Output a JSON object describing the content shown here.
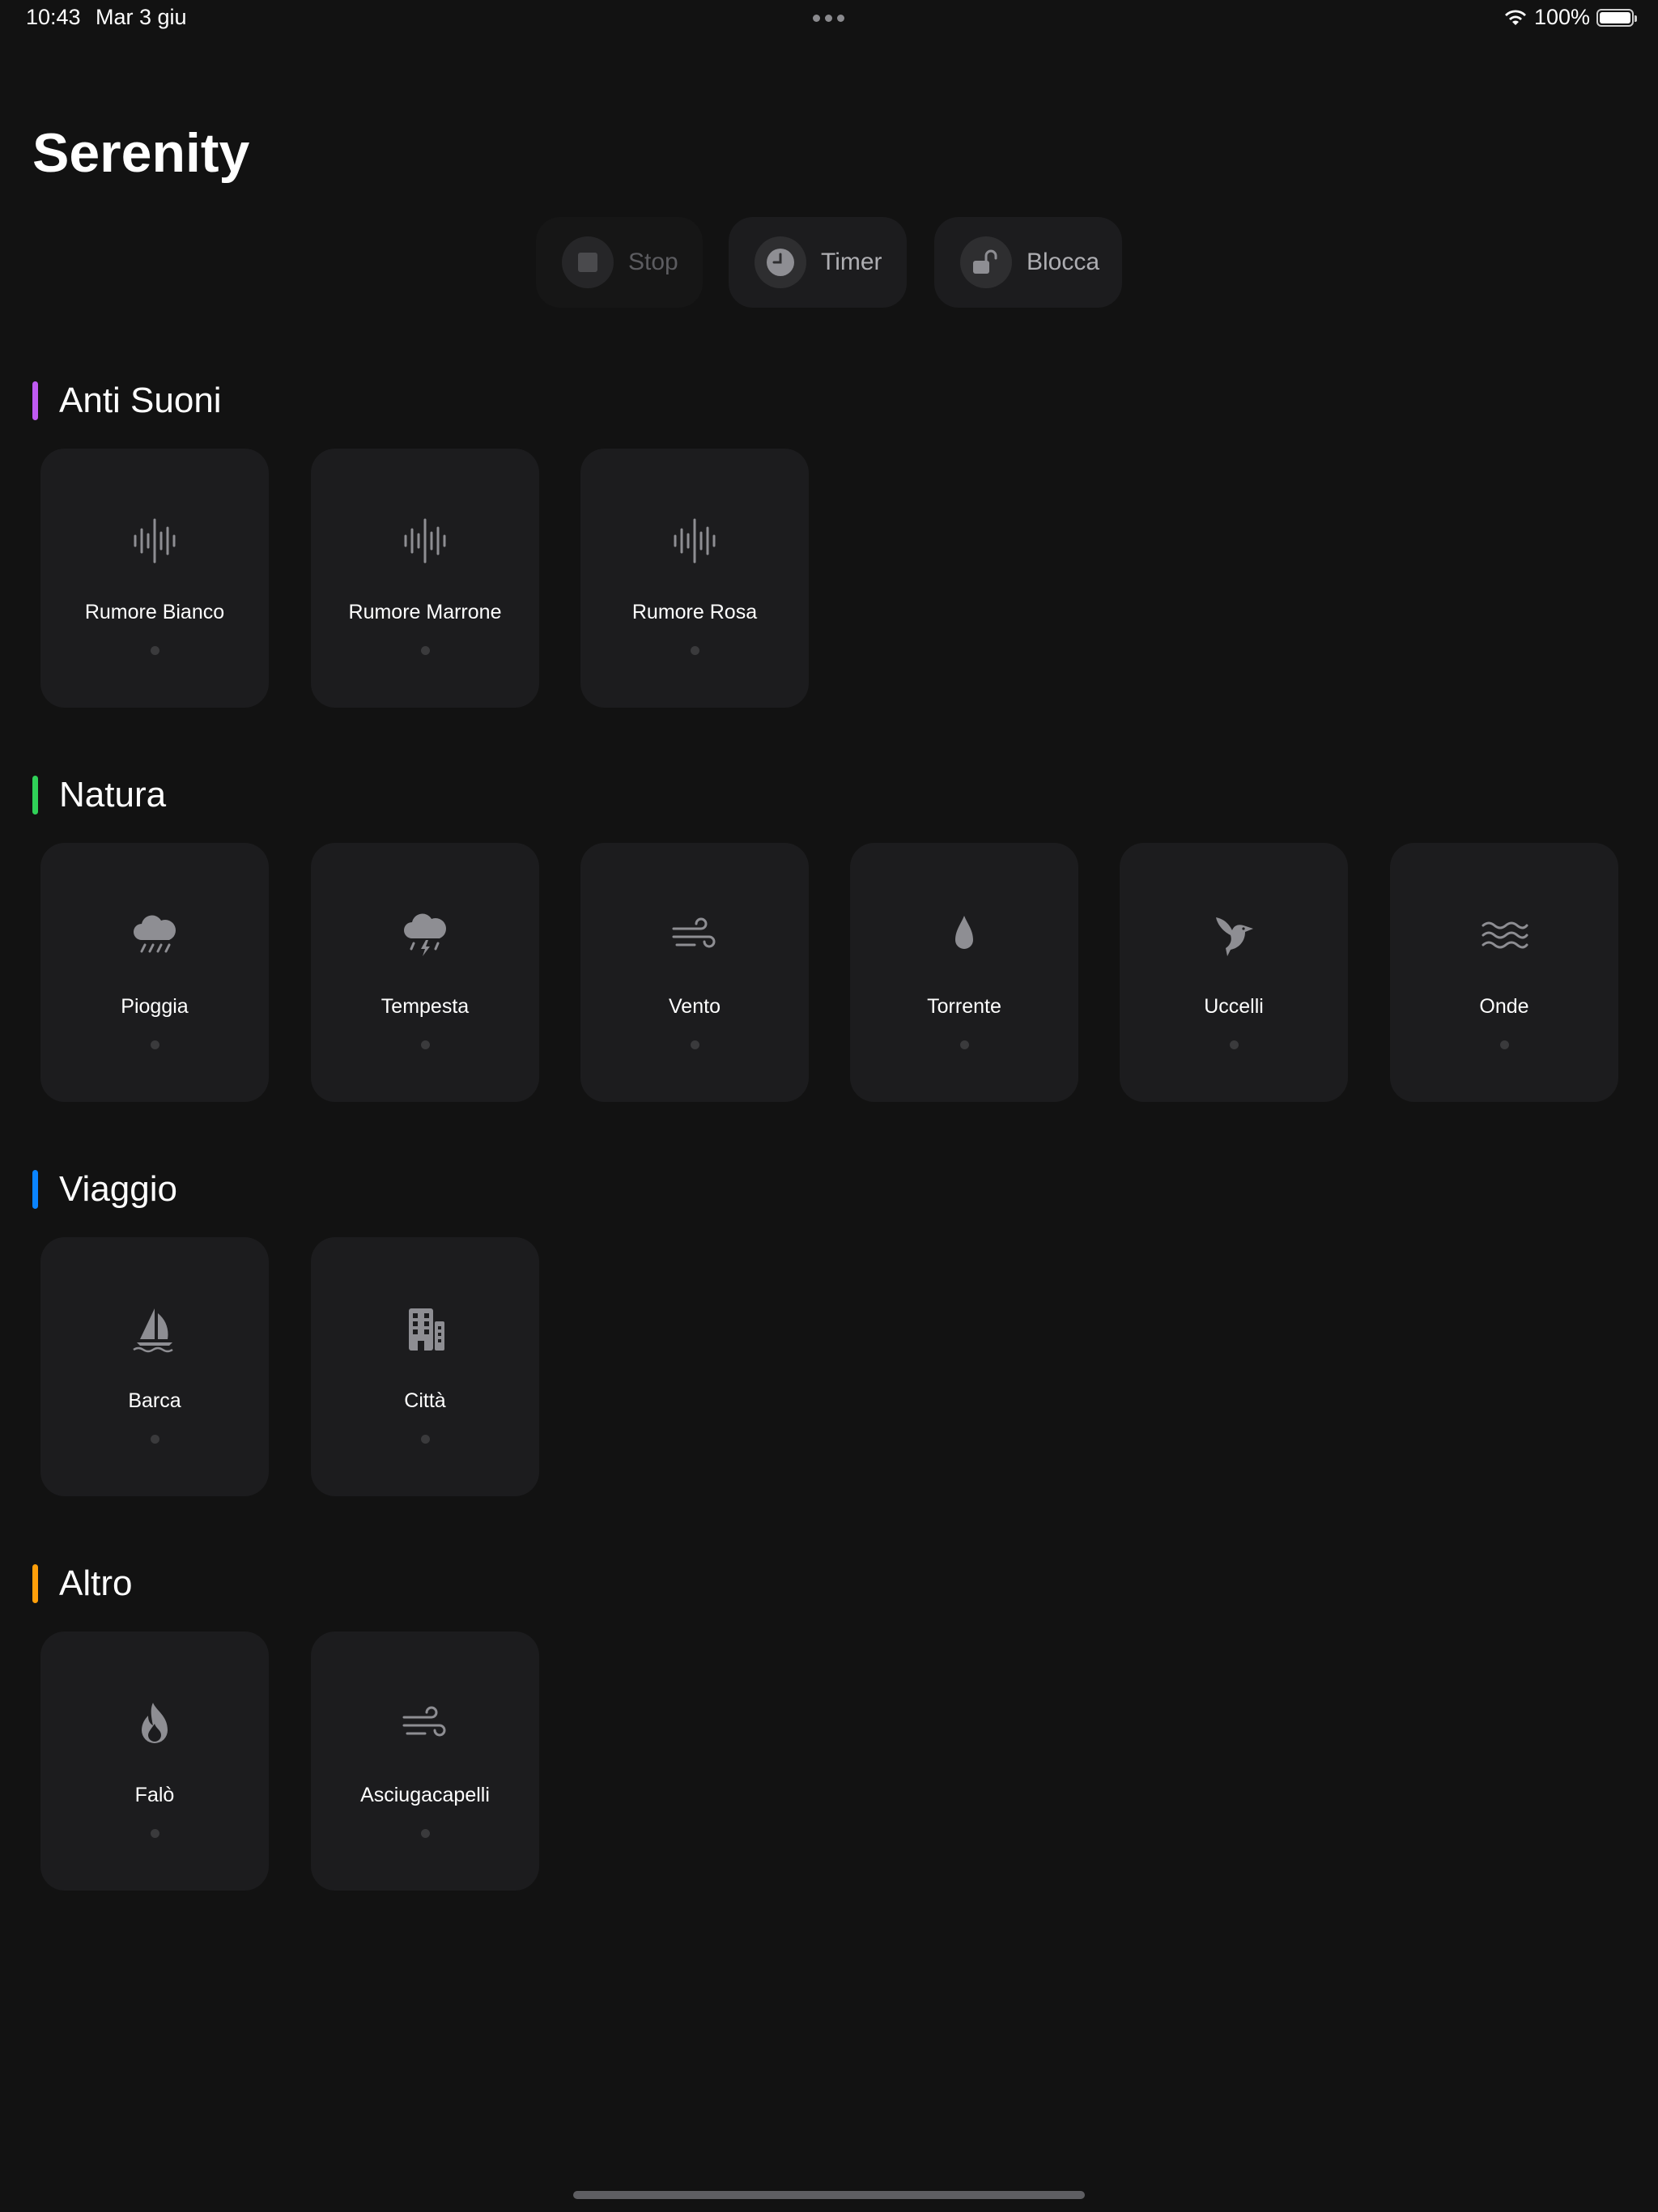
{
  "status_bar": {
    "time": "10:43",
    "date": "Mar 3 giu",
    "battery_text": "100%",
    "battery_level": 1.0
  },
  "header": {
    "title": "Serenity"
  },
  "controls": {
    "stop": {
      "label": "Stop",
      "icon": "stop-icon",
      "enabled": false
    },
    "timer": {
      "label": "Timer",
      "icon": "timer-icon",
      "enabled": true
    },
    "lock": {
      "label": "Blocca",
      "icon": "lock-open-icon",
      "enabled": true
    }
  },
  "colors": {
    "background": "#121212",
    "tile": "#1c1c1e",
    "icon": "#8e8e93",
    "anti_suoni": "#bf5af2",
    "natura": "#30d158",
    "viaggio": "#0a84ff",
    "altro": "#ff9f0a"
  },
  "sections": {
    "anti_suoni": {
      "title": "Anti Suoni",
      "items": [
        {
          "label": "Rumore Bianco",
          "icon": "waveform-icon"
        },
        {
          "label": "Rumore Marrone",
          "icon": "waveform-icon"
        },
        {
          "label": "Rumore Rosa",
          "icon": "waveform-icon"
        }
      ]
    },
    "natura": {
      "title": "Natura",
      "items": [
        {
          "label": "Pioggia",
          "icon": "cloud-rain-icon"
        },
        {
          "label": "Tempesta",
          "icon": "cloud-bolt-rain-icon"
        },
        {
          "label": "Vento",
          "icon": "wind-icon"
        },
        {
          "label": "Torrente",
          "icon": "drop-icon"
        },
        {
          "label": "Uccelli",
          "icon": "bird-icon"
        },
        {
          "label": "Onde",
          "icon": "water-waves-icon"
        }
      ]
    },
    "viaggio": {
      "title": "Viaggio",
      "items": [
        {
          "label": "Barca",
          "icon": "sailboat-icon"
        },
        {
          "label": "Città",
          "icon": "building-icon"
        }
      ]
    },
    "altro": {
      "title": "Altro",
      "items": [
        {
          "label": "Falò",
          "icon": "flame-icon"
        },
        {
          "label": "Asciugacapelli",
          "icon": "wind-icon"
        }
      ]
    }
  }
}
